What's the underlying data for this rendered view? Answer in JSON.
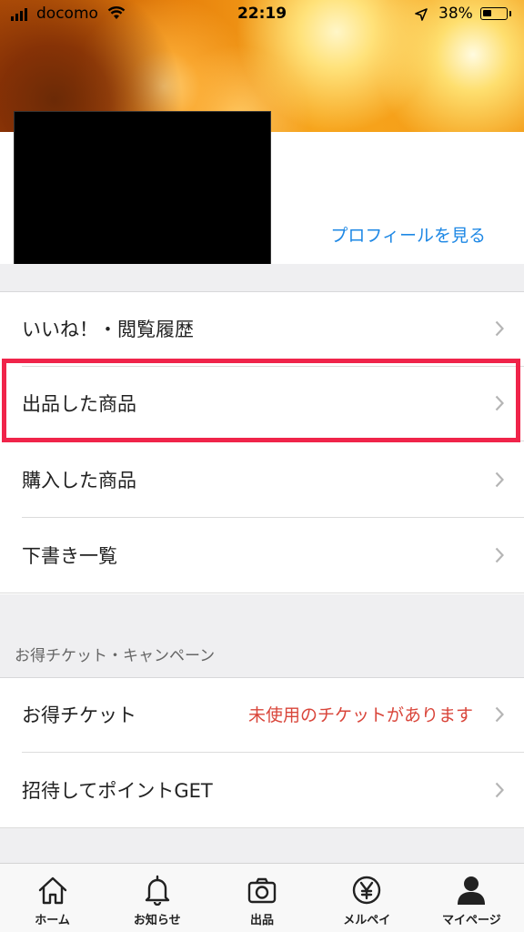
{
  "status_bar": {
    "carrier": "docomo",
    "time": "22:19",
    "battery_percent": "38%",
    "battery_level": 0.38
  },
  "profile": {
    "view_profile_link": "プロフィールを見る"
  },
  "menu": {
    "items": [
      {
        "label": "いいね！・閲覧履歴"
      },
      {
        "label": "出品した商品"
      },
      {
        "label": "購入した商品"
      },
      {
        "label": "下書き一覧"
      }
    ]
  },
  "tickets_section": {
    "title": "お得チケット・キャンペーン",
    "items": [
      {
        "label": "お得チケット",
        "note": "未使用のチケットがあります"
      },
      {
        "label": "招待してポイントGET"
      }
    ]
  },
  "tab_bar": {
    "tabs": [
      {
        "label": "ホーム",
        "icon": "home-icon"
      },
      {
        "label": "お知らせ",
        "icon": "bell-icon"
      },
      {
        "label": "出品",
        "icon": "camera-icon"
      },
      {
        "label": "メルペイ",
        "icon": "yen-icon"
      },
      {
        "label": "マイページ",
        "icon": "person-icon"
      }
    ]
  },
  "colors": {
    "link": "#1e88e5",
    "notice": "#d9453a",
    "highlight": "#f0244a"
  }
}
